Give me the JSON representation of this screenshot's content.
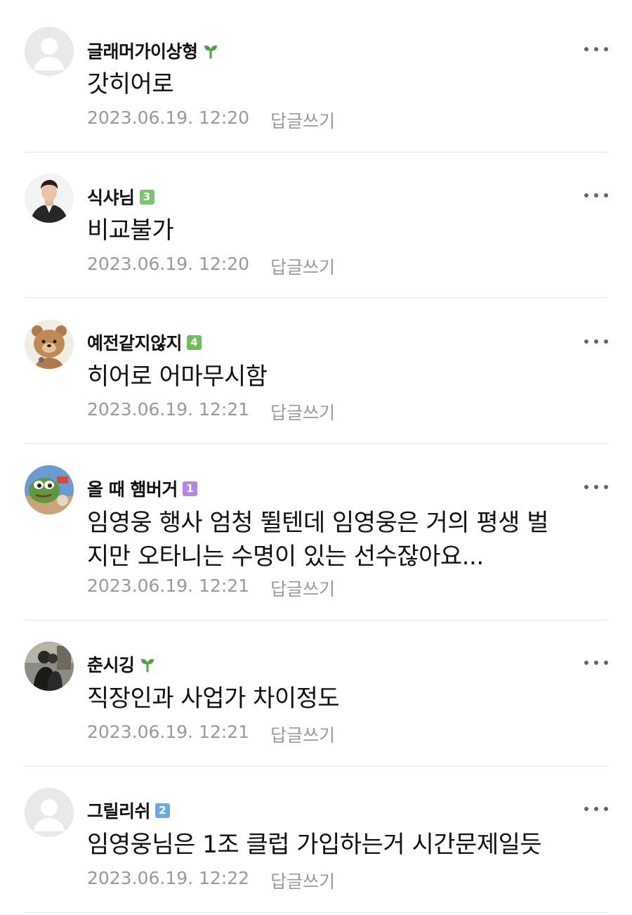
{
  "comments": [
    {
      "nickname": "글래머가이상형",
      "level": "",
      "level_icon": "sprout-icon",
      "avatar": "default-profile",
      "text": "갓히어로",
      "date": "2023.06.19. 12:20",
      "reply_label": "답글쓰기"
    },
    {
      "nickname": "식샤님",
      "level": "3",
      "level_color": "#7cc36e",
      "avatar": "man-in-suit-photo",
      "text": "비교불가",
      "date": "2023.06.19. 12:20",
      "reply_label": "답글쓰기"
    },
    {
      "nickname": "예전같지않지",
      "level": "4",
      "level_color": "#6cbf5a",
      "avatar": "brown-bear-character",
      "text": "히어로 어마무시함",
      "date": "2023.06.19. 12:21",
      "reply_label": "답글쓰기"
    },
    {
      "nickname": "올 때 햄버거",
      "level": "1",
      "level_color": "#b08ae0",
      "avatar": "frog-meme",
      "text_lines": [
        "임영웅 행사 엄청 뛸텐데 임영웅은 거의 평생 벌",
        "지만 오타니는 수명이 있는 선수잖아요..."
      ],
      "date": "2023.06.19. 12:21",
      "reply_label": "답글쓰기"
    },
    {
      "nickname": "춘시깅",
      "level": "",
      "level_icon": "sprout-icon",
      "avatar": "couple-photo",
      "text": "직장인과 사업가 차이정도",
      "date": "2023.06.19. 12:21",
      "reply_label": "답글쓰기"
    },
    {
      "nickname": "그릴리쉬",
      "level": "2",
      "level_color": "#6aa8e6",
      "avatar": "default-profile",
      "text": "임영웅님은 1조 클럽 가입하는거 시간문제일듯",
      "date": "2023.06.19. 12:22",
      "reply_label": "답글쓰기"
    }
  ],
  "colors": {
    "sprout": "#4aa33c",
    "meta_text": "#9a9a9a",
    "divider": "#e6e6e6"
  }
}
